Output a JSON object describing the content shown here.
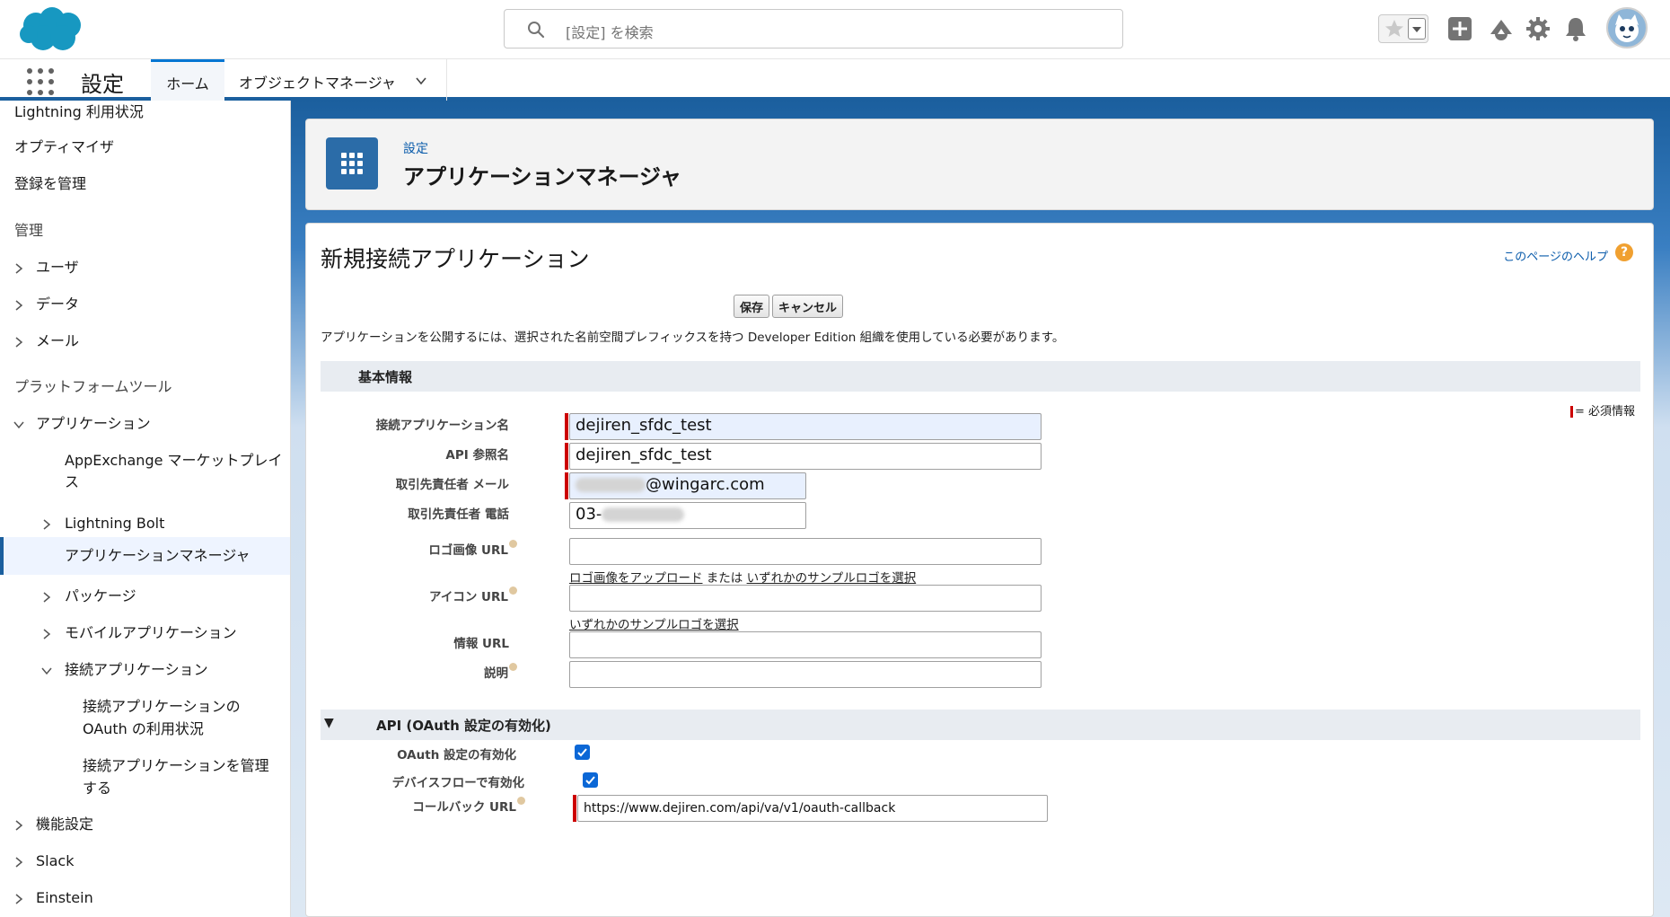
{
  "header": {
    "search_placeholder": "[設定] を検索"
  },
  "nav": {
    "app_title": "設定",
    "tab_home": "ホーム",
    "tab_object_manager": "オブジェクトマネージャ"
  },
  "sidebar": {
    "items": [
      {
        "label": "Lightning 利用状況"
      },
      {
        "label": "オプティマイザ"
      },
      {
        "label": "登録を管理"
      },
      {
        "label": "管理"
      },
      {
        "label": "ユーザ"
      },
      {
        "label": "データ"
      },
      {
        "label": "メール"
      },
      {
        "label": "プラットフォームツール"
      },
      {
        "label": "アプリケーション"
      },
      {
        "label": "AppExchange マーケットプレイ"
      },
      {
        "label": "ス"
      },
      {
        "label": "Lightning Bolt"
      },
      {
        "label": "アプリケーションマネージャ"
      },
      {
        "label": "パッケージ"
      },
      {
        "label": "モバイルアプリケーション"
      },
      {
        "label": "接続アプリケーション"
      },
      {
        "label": "接続アプリケーションの"
      },
      {
        "label": "OAuth の利用状況"
      },
      {
        "label": "接続アプリケーションを管理"
      },
      {
        "label": "する"
      },
      {
        "label": "機能設定"
      },
      {
        "label": "Slack"
      },
      {
        "label": "Einstein"
      }
    ]
  },
  "page_header": {
    "breadcrumb": "設定",
    "title": "アプリケーションマネージャ"
  },
  "form": {
    "title": "新規接続アプリケーション",
    "help_link": "このページのヘルプ",
    "help_icon": "?",
    "save_label": "保存",
    "cancel_label": "キャンセル",
    "notice": "アプリケーションを公開するには、選択された名前空間プレフィックスを持つ Developer Edition 組織を使用している必要があります。",
    "section_basic": "基本情報",
    "required_legend": "= 必須情報",
    "fields": {
      "app_name_label": "接続アプリケーション名",
      "app_name_value": "dejiren_sfdc_test",
      "api_name_label": "API 参照名",
      "api_name_value": "dejiren_sfdc_test",
      "email_label": "取引先責任者 メール",
      "email_value_suffix": "@wingarc.com",
      "phone_label": "取引先責任者 電話",
      "phone_value_prefix": "03-",
      "logo_url_label": "ロゴ画像 URL",
      "logo_upload_link": "ロゴ画像をアップロード",
      "logo_or": " または ",
      "logo_sample_link": "いずれかのサンプルロゴを選択",
      "icon_url_label": "アイコン URL",
      "icon_sample_link": "いずれかのサンプルロゴを選択",
      "info_url_label": "情報 URL",
      "description_label": "説明"
    },
    "section_api": "API (OAuth 設定の有効化)",
    "section_api_toggle": "▼",
    "oauth_enable_label": "OAuth 設定の有効化",
    "device_flow_label": "デバイスフローで有効化",
    "callback_url_label": "コールバック URL",
    "callback_url_value": "https://www.dejiren.com/api/va/v1/oauth-callback"
  }
}
